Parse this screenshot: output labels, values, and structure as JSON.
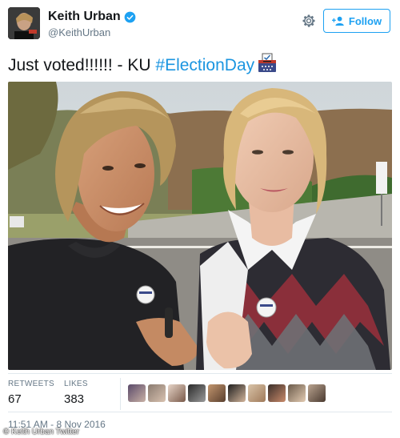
{
  "user": {
    "display_name": "Keith Urban",
    "handle": "@KeithUrban",
    "verified": true,
    "avatar_icon": "profile-photo"
  },
  "actions": {
    "settings_icon": "gear-icon",
    "follow_label": "Follow",
    "follow_icon": "person-plus-icon"
  },
  "tweet": {
    "text": "Just voted!!!!!! - KU ",
    "hashtag": "#ElectionDay",
    "emoji": "ballot-box-icon"
  },
  "stats": {
    "retweets_label": "RETWEETS",
    "retweets_value": "67",
    "likes_label": "LIKES",
    "likes_value": "383"
  },
  "likers_count_shown": 10,
  "timestamp": "11:51 AM - 8 Nov 2016",
  "credit": "© Keith Urban Twitter",
  "colors": {
    "accent": "#1da1f2",
    "hashtag": "#1b95e0",
    "text": "#14171a",
    "muted": "#657786",
    "border": "#e1e8ed"
  }
}
